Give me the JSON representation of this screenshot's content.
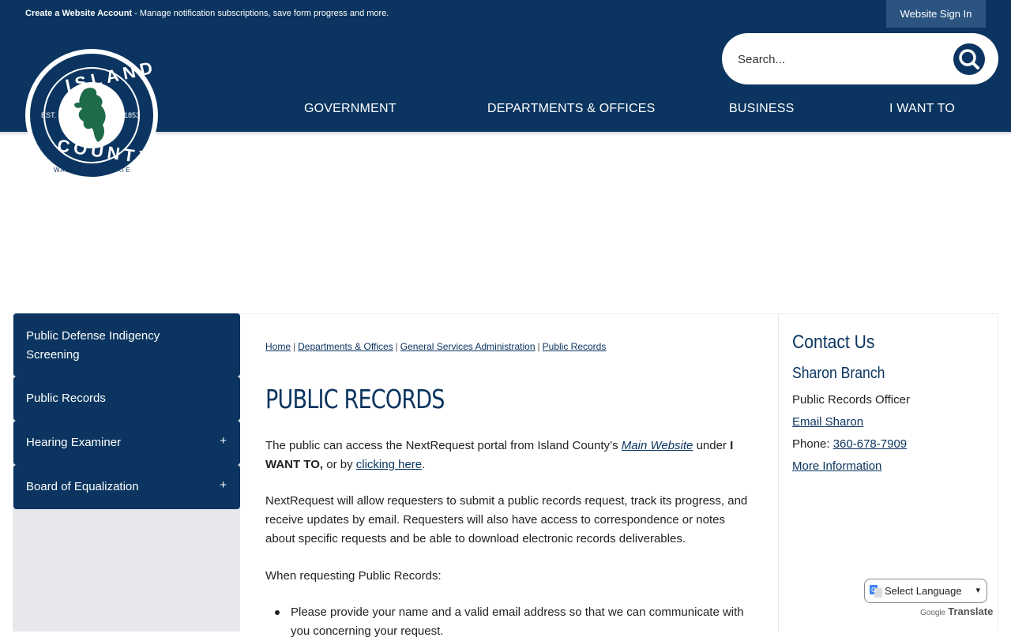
{
  "topbar": {
    "account_link": "Create a Website Account",
    "account_desc": "- Manage notification subscriptions, save form progress and more.",
    "signin": "Website Sign In"
  },
  "logo": {
    "top_text": "ISLAND",
    "bottom_text": "COUNTY",
    "sub_text": "WASHINGTON STATE",
    "est": "EST.",
    "year": "1853"
  },
  "search": {
    "placeholder": "Search..."
  },
  "nav": [
    "GOVERNMENT",
    "DEPARTMENTS & OFFICES",
    "BUSINESS",
    "I WANT TO"
  ],
  "sidebar": {
    "items": [
      {
        "label": "Public Defense Indigency Screening"
      },
      {
        "label": "Public Records"
      },
      {
        "label": "Hearing Examiner",
        "expander": "+"
      },
      {
        "label": "Board of Equalization",
        "expander": "+"
      }
    ]
  },
  "breadcrumbs": [
    "Home",
    "Departments & Offices",
    "General Services Administration",
    "Public Records"
  ],
  "breadcrumb_sep": "|",
  "page_title": "PUBLIC RECORDS",
  "content": {
    "p1_a": "The public can access the NextRequest portal from Island County’s",
    "p1_link": "Main Website",
    "p1_b": " under",
    "p1_bold": "I WANT TO,",
    "p1_c": "or by",
    "p1_link2": "clicking here",
    "p1_end": ".",
    "p2": "NextRequest will allow requesters to submit a public records request, track its progress, and receive updates by email. Requesters will also have access to correspondence or notes about specific requests and be able to download electronic records deliverables.",
    "p3": "When requesting Public Records:",
    "bullet1": "Please provide your name and a valid email address so that we can communicate with you concerning your request."
  },
  "contact": {
    "heading": "Contact Us",
    "name": "Sharon Branch",
    "role": "Public Records Officer",
    "email_link": "Email Sharon",
    "phone_label": "Phone:",
    "phone": "360-678-7909",
    "more": "More Information"
  },
  "translate": {
    "select_label": "Select Language",
    "powered_by": "Google",
    "translate_word": "Translate"
  },
  "colors": {
    "navy": "#0b3560",
    "logo_green": "#1e6b4a"
  }
}
